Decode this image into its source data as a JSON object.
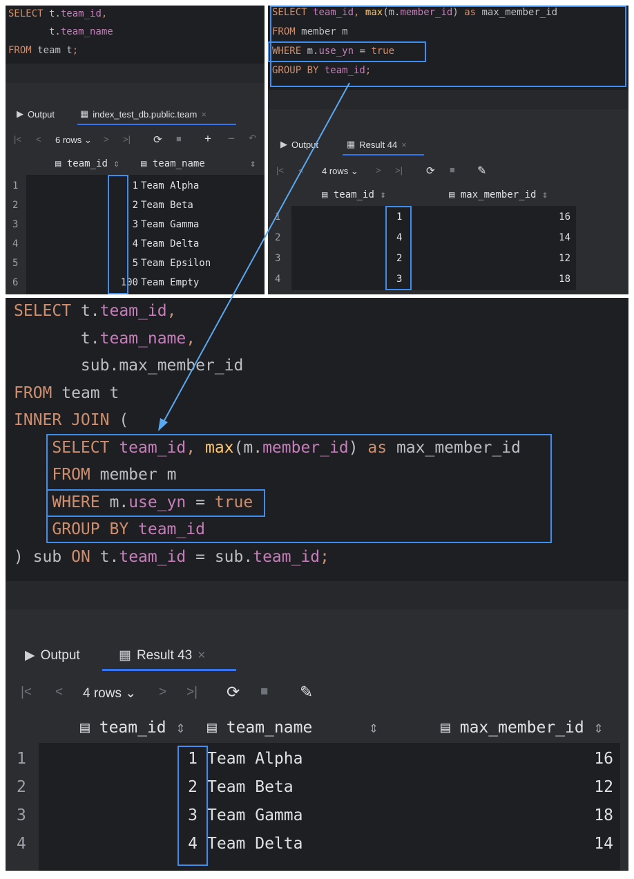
{
  "topLeft": {
    "code": [
      "SELECT t.team_id,",
      "       t.team_name",
      "FROM team t;"
    ],
    "tabs": {
      "output": "Output",
      "table": "index_test_db.public.team"
    },
    "toolbar": {
      "rows": "6 rows"
    },
    "columns": [
      "team_id",
      "team_name"
    ],
    "rows": [
      {
        "n": "1",
        "id": "1",
        "name": "Team Alpha"
      },
      {
        "n": "2",
        "id": "2",
        "name": "Team Beta"
      },
      {
        "n": "3",
        "id": "3",
        "name": "Team Gamma"
      },
      {
        "n": "4",
        "id": "4",
        "name": "Team Delta"
      },
      {
        "n": "5",
        "id": "5",
        "name": "Team Epsilon"
      },
      {
        "n": "6",
        "id": "100",
        "name": "Team Empty"
      }
    ]
  },
  "topRight": {
    "tabs": {
      "output": "Output",
      "result": "Result 44"
    },
    "toolbar": {
      "rows": "4 rows"
    },
    "columns": [
      "team_id",
      "max_member_id"
    ],
    "rows": [
      {
        "n": "1",
        "id": "1",
        "max": "16"
      },
      {
        "n": "2",
        "id": "4",
        "max": "14"
      },
      {
        "n": "3",
        "id": "2",
        "max": "12"
      },
      {
        "n": "4",
        "id": "3",
        "max": "18"
      }
    ]
  },
  "bottom": {
    "tabs": {
      "output": "Output",
      "result": "Result 43"
    },
    "toolbar": {
      "rows": "4 rows"
    },
    "columns": [
      "team_id",
      "team_name",
      "max_member_id"
    ],
    "rows": [
      {
        "n": "1",
        "id": "1",
        "name": "Team Alpha",
        "max": "16"
      },
      {
        "n": "2",
        "id": "2",
        "name": "Team Beta",
        "max": "12"
      },
      {
        "n": "3",
        "id": "3",
        "name": "Team Gamma",
        "max": "18"
      },
      {
        "n": "4",
        "id": "4",
        "name": "Team Delta",
        "max": "14"
      }
    ]
  },
  "colors": {
    "highlight": "#3d8ef0",
    "keyword": "#cf8e6d",
    "field": "#c77dbb",
    "background": "#1e1f22"
  }
}
